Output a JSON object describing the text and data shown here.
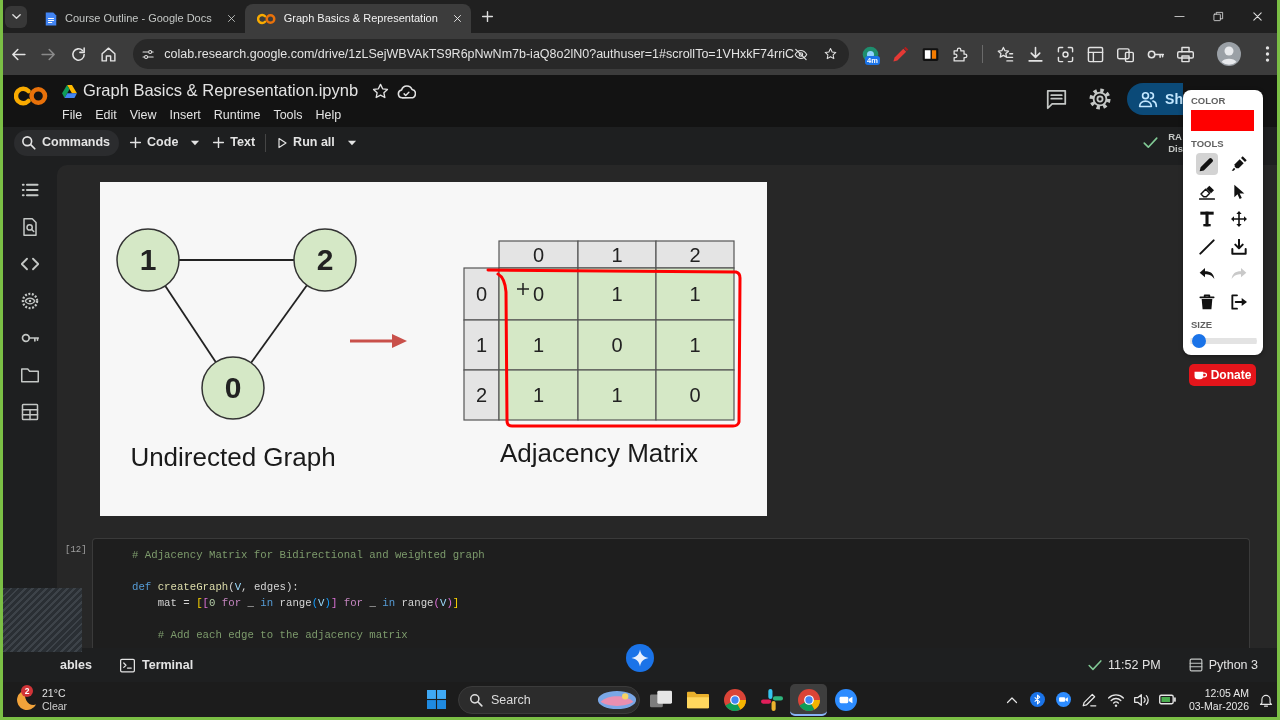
{
  "browser": {
    "tabs": [
      {
        "kind": "document",
        "title": "Course Outline - Google Docs",
        "selected": false
      },
      {
        "kind": "notebook",
        "title": "Graph Basics & Representation",
        "selected": true
      }
    ],
    "address": "colab.research.google.com/drive/1zLSejWBVAkTS9R6pNwNm7b-iaQ8o2lN0?authuser=1#scrollTo=1VHxkF74rriC",
    "extension_badge": "4m"
  },
  "notebook": {
    "title": "Graph Basics & Representation.ipynb",
    "menu": [
      "File",
      "Edit",
      "View",
      "Insert",
      "Runtime",
      "Tools",
      "Help"
    ],
    "share_button": "Sh",
    "toolbar": [
      {
        "kind": "search",
        "label": "Commands",
        "dropdown": false
      },
      {
        "kind": "add",
        "label": "Code",
        "dropdown": true
      },
      {
        "kind": "add",
        "label": "Text",
        "dropdown": false
      },
      {
        "kind": "run",
        "label": "Run all",
        "dropdown": true
      }
    ],
    "resources": [
      "RA",
      "Dis"
    ]
  },
  "figure": {
    "graph": {
      "nodes": [
        "1",
        "2",
        "0"
      ],
      "caption": "Undirected Graph"
    },
    "matrix": {
      "column_headers": [
        "0",
        "1",
        "2"
      ],
      "rows": [
        {
          "header": "0",
          "cells": [
            "0",
            "1",
            "1"
          ]
        },
        {
          "header": "1",
          "cells": [
            "1",
            "0",
            "1"
          ]
        },
        {
          "header": "2",
          "cells": [
            "1",
            "1",
            "0"
          ]
        }
      ],
      "caption": "Adjacency Matrix"
    }
  },
  "code_cell": {
    "execution_count": "[12]",
    "lines": [
      {
        "kind": "code",
        "tokens": [
          {
            "kind": "comment",
            "text": "# Adjacency Matrix for Bidirectional and weighted graph"
          }
        ]
      },
      {
        "kind": "blank"
      },
      {
        "kind": "code",
        "tokens": [
          {
            "kind": "keyword",
            "text": "def"
          },
          {
            "kind": "function",
            "text": " createGraph"
          },
          {
            "kind": "plain",
            "text": "("
          },
          {
            "kind": "param",
            "text": "V"
          },
          {
            "kind": "plain",
            "text": ", edges):"
          }
        ]
      },
      {
        "kind": "code",
        "tokens": [
          {
            "kind": "plain",
            "text": "    mat = "
          },
          {
            "kind": "bracket1",
            "text": "["
          },
          {
            "kind": "bracket2",
            "text": "["
          },
          {
            "kind": "number",
            "text": "0"
          },
          {
            "kind": "control",
            "text": " for"
          },
          {
            "kind": "plain",
            "text": " _ "
          },
          {
            "kind": "keyword",
            "text": "in"
          },
          {
            "kind": "plain",
            "text": " range"
          },
          {
            "kind": "bracket3",
            "text": "("
          },
          {
            "kind": "param",
            "text": "V"
          },
          {
            "kind": "bracket3",
            "text": ")"
          },
          {
            "kind": "bracket2",
            "text": "]"
          },
          {
            "kind": "control",
            "text": " for"
          },
          {
            "kind": "plain",
            "text": " _ "
          },
          {
            "kind": "keyword",
            "text": "in"
          },
          {
            "kind": "plain",
            "text": " range"
          },
          {
            "kind": "bracket2",
            "text": "("
          },
          {
            "kind": "param",
            "text": "V"
          },
          {
            "kind": "bracket2",
            "text": ")"
          },
          {
            "kind": "bracket1",
            "text": "]"
          }
        ]
      },
      {
        "kind": "blank"
      },
      {
        "kind": "code",
        "tokens": [
          {
            "kind": "comment",
            "text": "    # Add each edge to the adjacency matrix"
          }
        ]
      }
    ]
  },
  "status_bar": {
    "items": [
      {
        "kind": "text",
        "label": "ables"
      },
      {
        "kind": "terminal",
        "label": "Terminal"
      }
    ],
    "time": "11:52 PM",
    "kernel": "Python 3"
  },
  "drawing_toolbar": {
    "color_label": "COLOR",
    "color": "#ff0000",
    "tools_label": "TOOLS",
    "tools": [
      {
        "kind": "pencil",
        "selected": true,
        "disabled": false
      },
      {
        "kind": "marker",
        "selected": false,
        "disabled": false
      },
      {
        "kind": "eraser",
        "selected": false,
        "disabled": false
      },
      {
        "kind": "pointer",
        "selected": false,
        "disabled": false
      },
      {
        "kind": "text",
        "selected": false,
        "disabled": false
      },
      {
        "kind": "move",
        "selected": false,
        "disabled": false
      },
      {
        "kind": "line",
        "selected": false,
        "disabled": false
      },
      {
        "kind": "save",
        "selected": false,
        "disabled": false
      },
      {
        "kind": "undo",
        "selected": false,
        "disabled": false
      },
      {
        "kind": "redo",
        "selected": false,
        "disabled": true
      },
      {
        "kind": "clear",
        "selected": false,
        "disabled": false
      },
      {
        "kind": "exit",
        "selected": false,
        "disabled": false
      }
    ],
    "size_label": "SIZE",
    "size": {
      "level": 0.13
    },
    "donate_button": "Donate"
  },
  "taskbar": {
    "weather": {
      "badge": "2",
      "temperature": "21°C",
      "condition": "Clear"
    },
    "search": {
      "placeholder": "Search"
    },
    "apps": [
      {
        "kind": "task-view",
        "active": false
      },
      {
        "kind": "files",
        "active": false
      },
      {
        "kind": "browser",
        "active": false
      },
      {
        "kind": "chat",
        "active": false
      },
      {
        "kind": "browser",
        "active": true
      },
      {
        "kind": "meeting",
        "active": false
      }
    ],
    "clock": {
      "time": "12:05 AM",
      "date": "03-Mar-2026"
    }
  }
}
